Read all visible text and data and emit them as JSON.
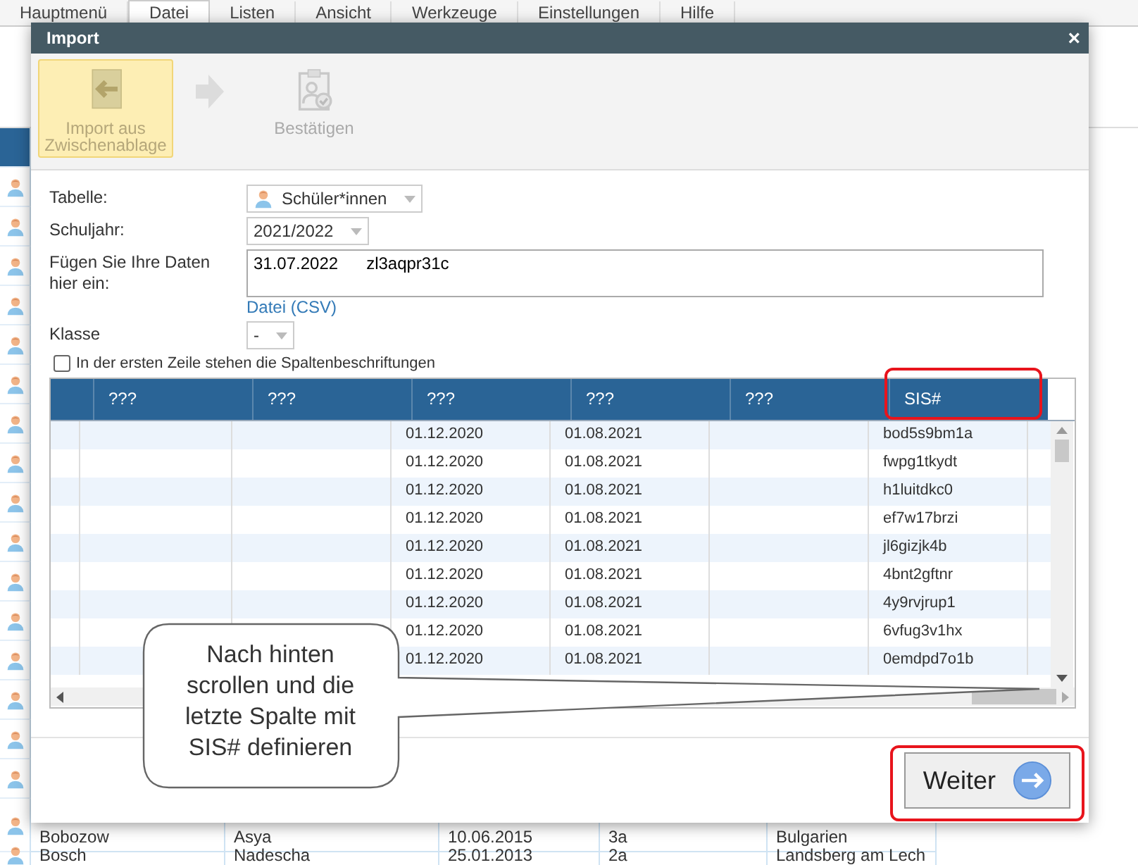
{
  "app_menu": [
    {
      "label": "Hauptmenü",
      "selected": false
    },
    {
      "label": "Datei",
      "selected": true
    },
    {
      "label": "Listen",
      "selected": false
    },
    {
      "label": "Ansicht",
      "selected": false
    },
    {
      "label": "Werkzeuge",
      "selected": false
    },
    {
      "label": "Einstellungen",
      "selected": false
    },
    {
      "label": "Hilfe",
      "selected": false
    }
  ],
  "background_rows": [
    {
      "cells": [
        "Bobozow",
        "Asya",
        "10.06.2015",
        "3a",
        "Bulgarien"
      ]
    },
    {
      "cells": [
        "Bosch",
        "Nadescha",
        "25.01.2013",
        "2a",
        "Landsberg am Lech"
      ]
    }
  ],
  "dialog": {
    "title": "Import",
    "close": "×",
    "toolbar": [
      {
        "kind": "step",
        "label": "Import aus Zwischenablage",
        "selected": true
      },
      {
        "kind": "arrow"
      },
      {
        "kind": "step",
        "label": "Bestätigen",
        "selected": false
      }
    ],
    "form": [
      {
        "kind": "select",
        "label": "Tabelle:",
        "value": "Schüler*innen",
        "icon": true
      },
      {
        "kind": "select",
        "label": "Schuljahr:",
        "value": "2021/2022",
        "icon": false
      },
      {
        "kind": "textarea",
        "label": "Fügen Sie Ihre Daten hier ein:",
        "value": "31.07.2022      zl3aqpr31c",
        "link": "Datei (CSV)"
      },
      {
        "kind": "select",
        "label": "Klasse",
        "value": "-",
        "icon": false
      }
    ],
    "header_checkbox": {
      "label": "In der ersten Zeile stehen die Spaltenbeschriftungen",
      "checked": false
    },
    "table": {
      "columns": [
        {
          "label": "???",
          "highlighted": false
        },
        {
          "label": "???",
          "highlighted": false
        },
        {
          "label": "???",
          "highlighted": false
        },
        {
          "label": "???",
          "highlighted": false
        },
        {
          "label": "???",
          "highlighted": false
        },
        {
          "label": "SIS#",
          "highlighted": true
        }
      ],
      "rows": [
        {
          "column_3": "01.12.2020",
          "column_4": "01.08.2021",
          "column_6": "bod5s9bm1a"
        },
        {
          "column_3": "01.12.2020",
          "column_4": "01.08.2021",
          "column_6": "fwpg1tkydt"
        },
        {
          "column_3": "01.12.2020",
          "column_4": "01.08.2021",
          "column_6": "h1luitdkc0"
        },
        {
          "column_3": "01.12.2020",
          "column_4": "01.08.2021",
          "column_6": "ef7w17brzi"
        },
        {
          "column_3": "01.12.2020",
          "column_4": "01.08.2021",
          "column_6": "jl6gizjk4b"
        },
        {
          "column_3": "01.12.2020",
          "column_4": "01.08.2021",
          "column_6": "4bnt2gftnr"
        },
        {
          "column_3": "01.12.2020",
          "column_4": "01.08.2021",
          "column_6": "4y9rvjrup1"
        },
        {
          "column_3": "01.12.2020",
          "column_4": "01.08.2021",
          "column_6": "6vfug3v1hx"
        },
        {
          "column_3": "01.12.2020",
          "column_4": "01.08.2021",
          "column_6": "0emdpd7o1b"
        }
      ]
    },
    "callout": "Nach hinten scrollen und die letzte Spalte mit SIS# definieren",
    "next_button": {
      "label": "Weiter",
      "highlighted": true
    }
  }
}
